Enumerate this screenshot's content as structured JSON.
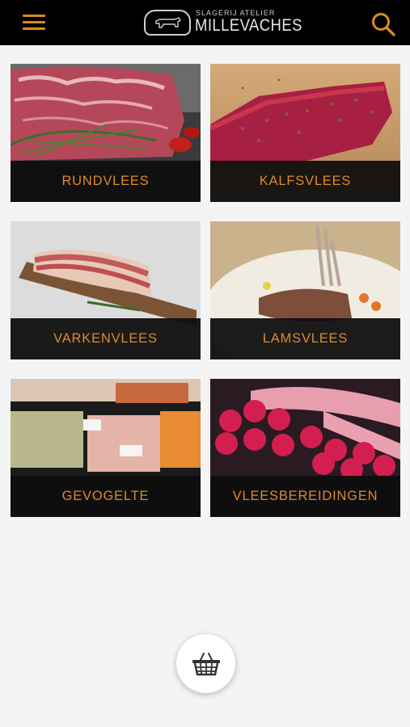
{
  "header": {
    "logo_subtitle": "SLAGERIJ ATELIER",
    "logo_title": "MILLEVACHES",
    "menu_icon": "hamburger-menu-icon",
    "search_icon": "search-icon",
    "accent_color": "#d98a1f",
    "background_color": "#000000"
  },
  "categories": [
    {
      "label": "RUNDVLEES",
      "image": "beef-steak-rosemary"
    },
    {
      "label": "KALFSVLEES",
      "image": "veal-cut-peppercorns"
    },
    {
      "label": "VARKENVLEES",
      "image": "pork-belly-board"
    },
    {
      "label": "LAMSVLEES",
      "image": "lamb-rack-plate"
    },
    {
      "label": "GEVOGELTE",
      "image": "poultry-display-counter"
    },
    {
      "label": "VLEESBEREIDINGEN",
      "image": "sausages-burgers-counter"
    }
  ],
  "footer": {
    "cart_icon": "basket-icon"
  }
}
